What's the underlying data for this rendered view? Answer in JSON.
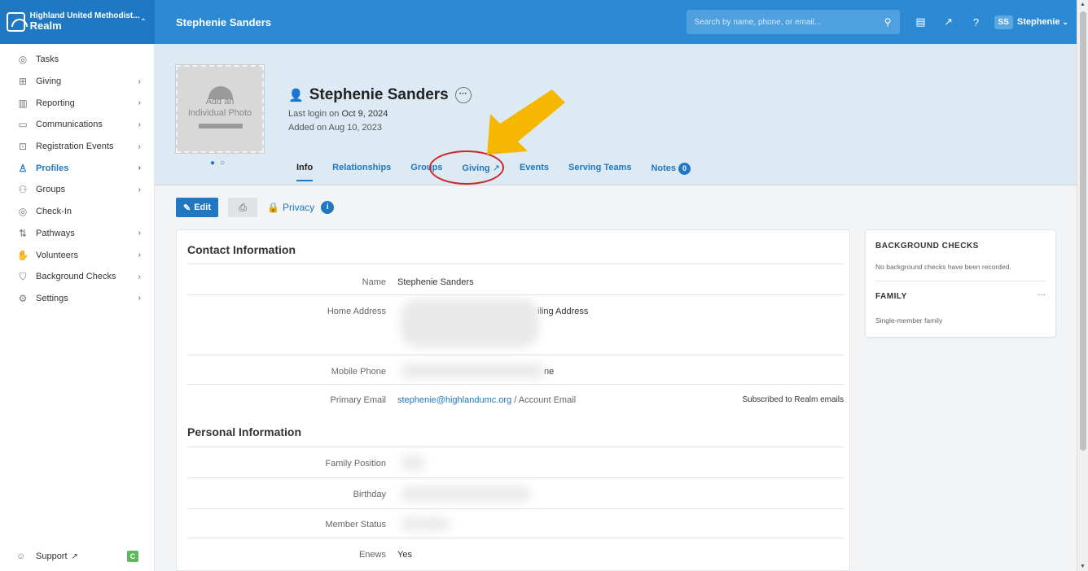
{
  "topbar": {
    "org_name": "Highland United Methodist...",
    "app_name": "Realm",
    "page_title": "Stephenie Sanders",
    "search_placeholder": "Search by name, phone, or email...",
    "user_initials": "SS",
    "user_name": "Stephenie"
  },
  "sidebar": {
    "items": [
      {
        "label": "Tasks",
        "icon": "check-circle-icon"
      },
      {
        "label": "Giving",
        "icon": "giving-icon"
      },
      {
        "label": "Reporting",
        "icon": "chart-icon"
      },
      {
        "label": "Communications",
        "icon": "chat-icon"
      },
      {
        "label": "Registration Events",
        "icon": "star-box-icon"
      },
      {
        "label": "Profiles",
        "icon": "profiles-icon"
      },
      {
        "label": "Groups",
        "icon": "groups-icon"
      },
      {
        "label": "Check-In",
        "icon": "check-circle-icon"
      },
      {
        "label": "Pathways",
        "icon": "pathways-icon"
      },
      {
        "label": "Volunteers",
        "icon": "hand-icon"
      },
      {
        "label": "Background Checks",
        "icon": "shield-icon"
      },
      {
        "label": "Settings",
        "icon": "gear-icon"
      }
    ],
    "support_label": "Support",
    "support_badge": "C"
  },
  "profile": {
    "photo_text_1": "Add an",
    "photo_text_2": "Individual Photo",
    "name": "Stephenie Sanders",
    "last_login_prefix": "Last login on",
    "last_login_date": "Oct 9, 2024",
    "added": "Added on Aug 10, 2023",
    "tabs": [
      "Info",
      "Relationships",
      "Groups",
      "Giving",
      "Events",
      "Serving Teams",
      "Notes"
    ],
    "notes_count": "0"
  },
  "actions": {
    "edit_label": "Edit",
    "privacy_label": "Privacy"
  },
  "contact": {
    "title": "Contact Information",
    "name_label": "Name",
    "name_value": "Stephenie Sanders",
    "home_address_label": "Home Address",
    "mailing_address_partial": "iling Address",
    "mobile_phone_label": "Mobile Phone",
    "phone_partial": "ne",
    "primary_email_label": "Primary Email",
    "primary_email_value": "stephenie@highlandumc.org",
    "account_email_label": "/ Account Email",
    "subscribed_note": "Subscribed to Realm emails"
  },
  "personal": {
    "title": "Personal Information",
    "family_position_label": "Family Position",
    "birthday_label": "Birthday",
    "member_status_label": "Member Status",
    "enews_label": "Enews",
    "enews_value": "Yes"
  },
  "side": {
    "bg_title": "BACKGROUND CHECKS",
    "bg_text": "No background checks have been recorded.",
    "family_title": "FAMILY",
    "family_text": "Single-member family"
  },
  "colors": {
    "topbar": "#2b8ad3",
    "accent": "#1f78c1",
    "annotation_arrow": "#f5b700",
    "annotation_ellipse": "#c9282d"
  }
}
